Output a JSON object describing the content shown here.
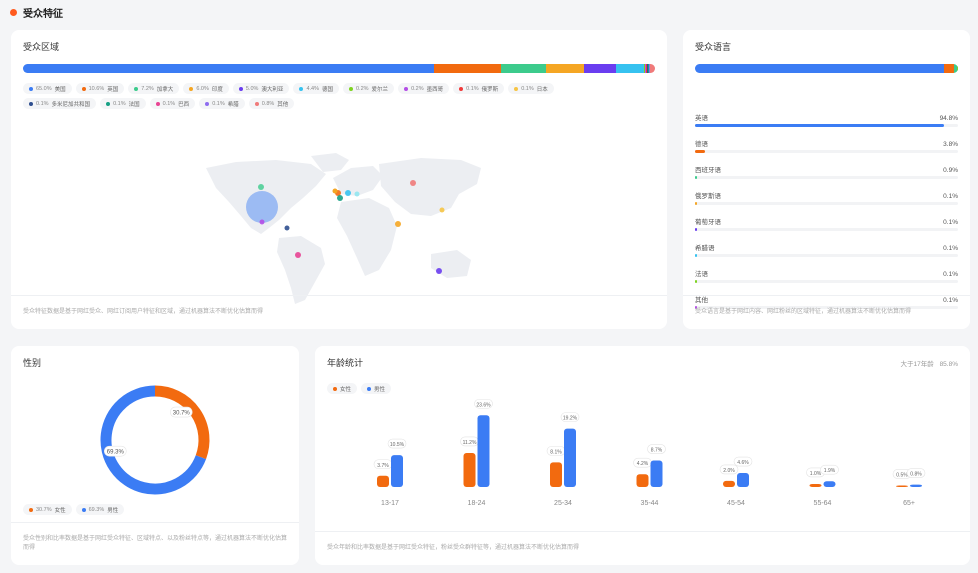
{
  "page": {
    "title": "受众特征"
  },
  "region": {
    "title": "受众区域",
    "segments": [
      {
        "name": "美国",
        "value": "65.0%",
        "pct": 65.0,
        "color": "#3b7cf4"
      },
      {
        "name": "英国",
        "value": "10.6%",
        "pct": 10.6,
        "color": "#f26a0f"
      },
      {
        "name": "加拿大",
        "value": "7.2%",
        "pct": 7.2,
        "color": "#3ccb8c"
      },
      {
        "name": "印度",
        "value": "6.0%",
        "pct": 6.0,
        "color": "#f5a623"
      },
      {
        "name": "澳大利亚",
        "value": "5.0%",
        "pct": 5.0,
        "color": "#6a3df0"
      },
      {
        "name": "德国",
        "value": "4.4%",
        "pct": 4.4,
        "color": "#36c2f0"
      },
      {
        "name": "爱尔兰",
        "value": "0.2%",
        "pct": 0.2,
        "color": "#7ed321"
      },
      {
        "name": "墨西哥",
        "value": "0.2%",
        "pct": 0.2,
        "color": "#b44ee6"
      },
      {
        "name": "俄罗斯",
        "value": "0.1%",
        "pct": 0.1,
        "color": "#f03a3a"
      },
      {
        "name": "日本",
        "value": "0.1%",
        "pct": 0.1,
        "color": "#f6c445"
      },
      {
        "name": "多米尼加共和国",
        "value": "0.1%",
        "pct": 0.1,
        "color": "#2f4f8f"
      },
      {
        "name": "法国",
        "value": "0.1%",
        "pct": 0.1,
        "color": "#16a085"
      },
      {
        "name": "巴西",
        "value": "0.1%",
        "pct": 0.1,
        "color": "#e84393"
      },
      {
        "name": "希腊",
        "value": "0.1%",
        "pct": 0.1,
        "color": "#8e6cf0"
      },
      {
        "name": "其他",
        "value": "0.8%",
        "pct": 0.8,
        "color": "#f07a7a"
      }
    ],
    "footnote": "受众特征数据是基于网红受众、网红订阅用户特征和区域，通过机器算法不断优化估算而得"
  },
  "language": {
    "title": "受众语言",
    "items": [
      {
        "name": "英语",
        "value": "94.8%",
        "pct": 94.8,
        "color": "#3b7cf4"
      },
      {
        "name": "德语",
        "value": "3.8%",
        "pct": 3.8,
        "color": "#f26a0f"
      },
      {
        "name": "西班牙语",
        "value": "0.9%",
        "pct": 0.9,
        "color": "#3ccb8c"
      },
      {
        "name": "俄罗斯语",
        "value": "0.1%",
        "pct": 0.1,
        "color": "#f5a623"
      },
      {
        "name": "葡萄牙语",
        "value": "0.1%",
        "pct": 0.1,
        "color": "#6a3df0"
      },
      {
        "name": "希腊语",
        "value": "0.1%",
        "pct": 0.1,
        "color": "#36c2f0"
      },
      {
        "name": "法语",
        "value": "0.1%",
        "pct": 0.1,
        "color": "#7ed321"
      },
      {
        "name": "其他",
        "value": "0.1%",
        "pct": 0.1,
        "color": "#b44ee6"
      }
    ],
    "footnote": "受众语言是基于网红内容、网红粉丝的区域特征，通过机器算法不断优化估算而得"
  },
  "gender": {
    "title": "性别",
    "female": {
      "label": "女性",
      "value": "30.7%",
      "pct": 30.7,
      "color": "#f26a0f"
    },
    "male": {
      "label": "男性",
      "value": "69.3%",
      "pct": 69.3,
      "color": "#3b7cf4"
    },
    "footnote": "受众性别和比率数据是基于网红受众特征、区域特点、以及粉丝特点等，通过机器算法不断优化估算而得"
  },
  "age": {
    "title": "年龄统计",
    "summary_label": "大于17年龄",
    "summary_value": "85.8%",
    "legend_female": "女性",
    "legend_male": "男性",
    "footnote": "受众年龄和比率数据是基于网红受众特征，粉丝受众群特征等，通过机器算法不断优化估算而得"
  },
  "chart_data": {
    "type": "bar",
    "categories": [
      "13-17",
      "18-24",
      "25-34",
      "35-44",
      "45-54",
      "55-64",
      "65+"
    ],
    "series": [
      {
        "name": "女性",
        "values": [
          3.7,
          11.2,
          8.1,
          4.2,
          2.0,
          1.0,
          0.5
        ],
        "labels": [
          "3.7%",
          "11.2%",
          "8.1%",
          "4.2%",
          "2.0%",
          "1.0%",
          "0.5%"
        ],
        "color": "#f26a0f"
      },
      {
        "name": "男性",
        "values": [
          10.5,
          23.6,
          19.2,
          8.7,
          4.6,
          1.9,
          0.8
        ],
        "labels": [
          "10.5%",
          "23.6%",
          "19.2%",
          "8.7%",
          "4.6%",
          "1.9%",
          "0.8%"
        ],
        "color": "#3b7cf4"
      }
    ],
    "ylim": [
      0,
      25
    ]
  },
  "map_points": [
    {
      "name": "美国",
      "color": "#3b7cf4"
    },
    {
      "name": "英国",
      "color": "#f26a0f"
    },
    {
      "name": "加拿大",
      "color": "#3ccb8c"
    },
    {
      "name": "印度",
      "color": "#f5a623"
    },
    {
      "name": "澳大利亚",
      "color": "#6a3df0"
    },
    {
      "name": "德国",
      "color": "#36c2f0"
    },
    {
      "name": "墨西哥",
      "color": "#b44ee6"
    },
    {
      "name": "俄罗斯",
      "color": "#f07a7a"
    },
    {
      "name": "日本",
      "color": "#f6c445"
    },
    {
      "name": "巴西",
      "color": "#e84393"
    },
    {
      "name": "法国",
      "color": "#16a085"
    },
    {
      "name": "多米尼加共和国",
      "color": "#2f4f8f"
    }
  ]
}
